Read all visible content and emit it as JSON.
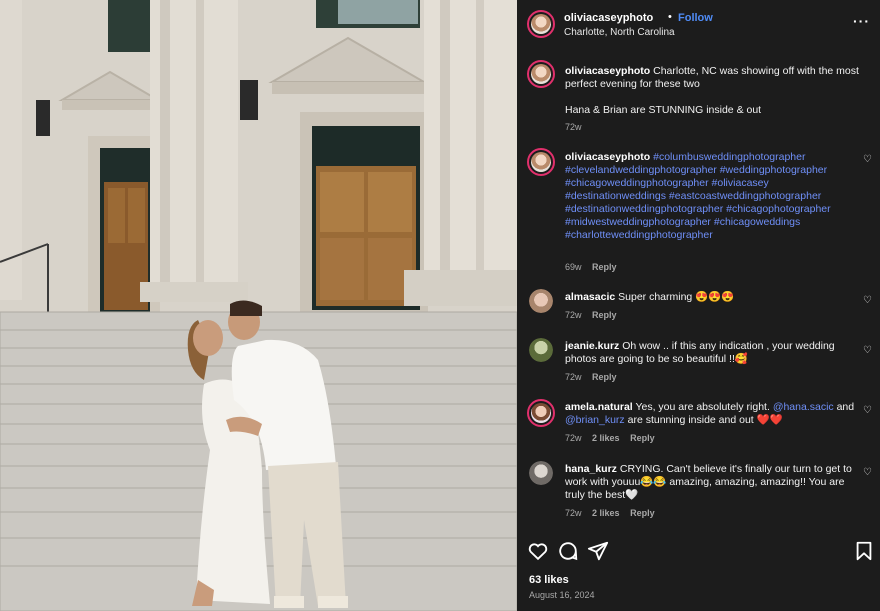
{
  "post": {
    "username": "oliviacaseyphoto",
    "separator": "•",
    "follow_label": "Follow",
    "location": "Charlotte, North Carolina",
    "more_label": "···"
  },
  "caption": {
    "username": "oliviacaseyphoto",
    "line1": "Charlotte, NC was showing off with the most perfect evening for these two",
    "line2": "Hana & Brian are STUNNING inside & out",
    "time": "72w"
  },
  "tags_comment": {
    "username": "oliviacaseyphoto",
    "hashtags": [
      "#columbusweddingphotographer",
      "#clevelandweddingphotographer",
      "#weddingphotographer",
      "#chicagoweddingphotographer",
      "#oliviacasey",
      "#destinationweddings",
      "#eastcoastweddingphotographer",
      "#destinationweddingphotographer",
      "#chicagophotographer",
      "#midwestweddingphotographer",
      "#chicagoweddings",
      "#charlotteweddingphotographer"
    ],
    "time": "69w",
    "reply": "Reply"
  },
  "comments": [
    {
      "username": "almasacic",
      "text": "Super charming 😍😍😍",
      "time": "72w",
      "likes": "",
      "reply": "Reply"
    },
    {
      "username": "jeanie.kurz",
      "text": "Oh wow .. if this any indication , your wedding photos are going to be so beautiful !!🥰",
      "time": "72w",
      "likes": "",
      "reply": "Reply"
    },
    {
      "username": "amela.natural",
      "text_a": "Yes, you are absolutely right.",
      "mention1": "@hana.sacic",
      "text_b": "and",
      "mention2": "@brian_kurz",
      "text_c": "are stunning inside and out ❤️❤️",
      "time": "72w",
      "likes": "2 likes",
      "reply": "Reply"
    },
    {
      "username": "hana_kurz",
      "text": "CRYING. Can't believe it's finally our turn to get to work with youuu😂😂 amazing, amazing, amazing!! You are truly the best🤍",
      "time": "72w",
      "likes": "2 likes",
      "reply": "Reply"
    }
  ],
  "footer": {
    "likes": "63 likes",
    "date": "August 16, 2024"
  },
  "icons": {
    "like": "heart-icon",
    "comment": "comment-icon",
    "share": "share-icon",
    "save": "bookmark-icon"
  },
  "colors": {
    "panel_bg": "#1c1c1c",
    "link_blue": "#6f8ff7",
    "follow_blue": "#4f8bf5",
    "meta_gray": "#a8a8a8"
  }
}
